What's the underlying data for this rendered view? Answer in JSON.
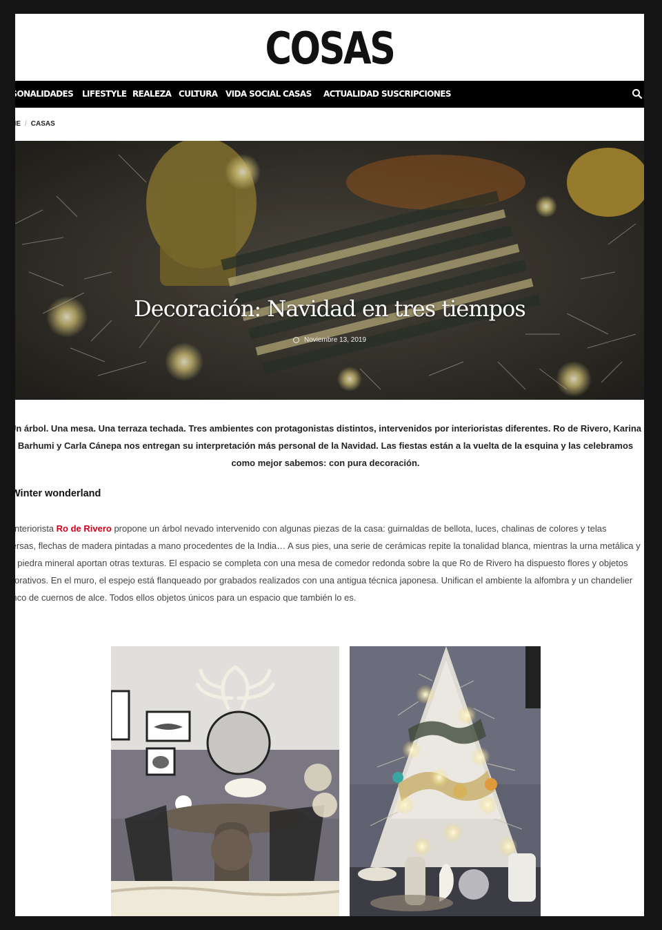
{
  "site": {
    "logo": "COSAS"
  },
  "nav": {
    "items": [
      "PERSONALIDADES",
      "LIFESTYLE",
      "REALEZA",
      "CULTURA",
      "VIDA SOCIAL",
      "CASAS",
      "ACTUALIDAD",
      "SUSCRIPCIONES"
    ]
  },
  "breadcrumb": {
    "home": "HOME",
    "separator": "/",
    "current": "CASAS"
  },
  "article": {
    "title": "Decoración: Navidad en tres tiempos",
    "date": "Noviembre 13, 2019",
    "intro": "Un árbol. Una mesa. Una terraza techada. Tres ambientes con protagonistas distintos, intervenidos por interioristas diferentes. Ro de Rivero, Karina Barhumi y Carla Cánepa nos entregan su interpretación más personal de la Navidad. Las fiestas están a la vuelta de la esquina y las celebramos como mejor sabemos: con pura decoración.",
    "section_title": "Winter wonderland",
    "paragraph_before_link": "La interiorista ",
    "link_text": "Ro de Rivero",
    "paragraph_after_link": " propone un árbol nevado intervenido con algunas piezas de la casa: guirnaldas de bellota, luces, chalinas de colores y telas diversas, flechas de madera pintadas a mano procedentes de la India… A sus pies, una serie de cerámicas repite la tonalidad blanca, mientras la urna metálica y una piedra mineral aportan otras texturas. El espacio se completa con una mesa de comedor redonda sobre la que Ro de Rivero ha dispuesto flores y objetos decorativos. En el muro, el espejo está flanqueado por grabados realizados con una antigua técnica japonesa. Unifican el ambiente la alfombra y un chandelier blanco de cuernos de alce. Todos ellos objetos únicos para un espacio que también lo es."
  },
  "colors": {
    "accent": "#d0021b",
    "nav_bg": "#000000"
  },
  "icons": {
    "search": "search-icon",
    "date": "clock-icon"
  }
}
